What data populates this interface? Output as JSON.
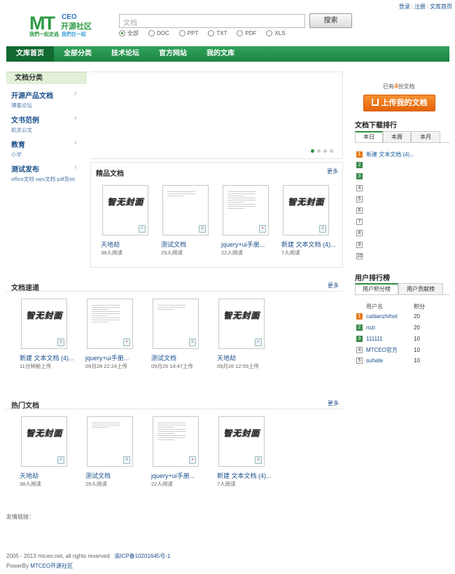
{
  "top_links": {
    "login": "登录",
    "register": "注册",
    "home": "文库首页",
    "sep": "|"
  },
  "logo": {
    "mt": "MT",
    "ceo": "CEO",
    "cn": "开源社区",
    "slogan_a": "我們一起走過",
    "slogan_b": "我們在一起"
  },
  "search": {
    "placeholder": "文档",
    "button": "搜索",
    "types": [
      {
        "label": "全部",
        "checked": true
      },
      {
        "label": "DOC",
        "checked": false
      },
      {
        "label": "PPT",
        "checked": false
      },
      {
        "label": "TXT",
        "checked": false
      },
      {
        "label": "PDF",
        "checked": false
      },
      {
        "label": "XLS",
        "checked": false
      }
    ]
  },
  "nav": [
    "文库首页",
    "全部分类",
    "技术论坛",
    "官方网站",
    "我的文库"
  ],
  "sidebar": {
    "title": "文档分类",
    "items": [
      {
        "title": "开源产品文档",
        "sub": "博客论坛"
      },
      {
        "title": "文书范例",
        "sub": "机关公文"
      },
      {
        "title": "教育",
        "sub": "小学"
      },
      {
        "title": "测试发布",
        "sub": "office文档 wps文档 pdf及txt"
      }
    ]
  },
  "featured": {
    "title": "精品文档",
    "more": "更多",
    "docs": [
      {
        "name": "天地劫",
        "meta": "38人阅读",
        "thumb": "logo",
        "ftype": "W"
      },
      {
        "name": "测试文档",
        "meta": "29人阅读",
        "thumb": "text",
        "ftype": "T"
      },
      {
        "name": "jquery+ui手册...",
        "meta": "22人阅读",
        "thumb": "text",
        "ftype": "P"
      },
      {
        "name": "新建 文本文档 (4)...",
        "meta": "7人阅读",
        "thumb": "logo",
        "ftype": "T"
      }
    ]
  },
  "latest": {
    "title": "文档速递",
    "more": "更多",
    "docs": [
      {
        "name": "新建 文本文档 (4)...",
        "meta": "11分钟前上传",
        "thumb": "logo",
        "ftype": "T"
      },
      {
        "name": "jquery+ui手册...",
        "meta": "09月28 22:24上传",
        "thumb": "text",
        "ftype": "P"
      },
      {
        "name": "测试文档",
        "meta": "09月26 14:47上传",
        "thumb": "text",
        "ftype": "T"
      },
      {
        "name": "天地劫",
        "meta": "09月26 12:59上传",
        "thumb": "logo",
        "ftype": "W"
      }
    ]
  },
  "hot": {
    "title": "热门文档",
    "more": "更多",
    "docs": [
      {
        "name": "天地劫",
        "meta": "38人阅读",
        "thumb": "logo",
        "ftype": "W"
      },
      {
        "name": "测试文档",
        "meta": "29人阅读",
        "thumb": "text",
        "ftype": "T"
      },
      {
        "name": "jquery+ui手册...",
        "meta": "22人阅读",
        "thumb": "text",
        "ftype": "P"
      },
      {
        "name": "新建 文本文档 (4)...",
        "meta": "7人阅读",
        "thumb": "logo",
        "ftype": "T"
      }
    ]
  },
  "thumb_logo_text": "智无封面",
  "right": {
    "count_prefix": "已有",
    "count": "4",
    "count_suffix": "份文档",
    "upload": "上传我的文档",
    "download_rank": {
      "title": "文档下载排行",
      "tabs": [
        "本日",
        "本周",
        "本月"
      ],
      "items": [
        "新建 文本文档 (4)...",
        "",
        "",
        "",
        "",
        "",
        "",
        "",
        "",
        ""
      ]
    },
    "user_rank": {
      "title": "用户排行榜",
      "tabs": [
        "用户积分榜",
        "用户贡献榜"
      ],
      "col_name": "用户名",
      "col_score": "积分",
      "rows": [
        {
          "name": "caitianzhihot",
          "score": "20"
        },
        {
          "name": "rozi",
          "score": "20"
        },
        {
          "name": "111111",
          "score": "10"
        },
        {
          "name": "MTCEO官方",
          "score": "10"
        },
        {
          "name": "suhate",
          "score": "10"
        }
      ]
    }
  },
  "friend_links": "友情链接：",
  "footer": {
    "copyright": "2005 - 2013 mtceo.net, all rights reserved",
    "icp": "渝ICP备10201645号-1",
    "powered_prefix": "PowerBy",
    "powered_link": "MTCEO开源社区"
  },
  "colors": {
    "brand_green": "#1e8442",
    "accent_orange": "#e87b1c",
    "link_blue": "#1a4f8c"
  }
}
